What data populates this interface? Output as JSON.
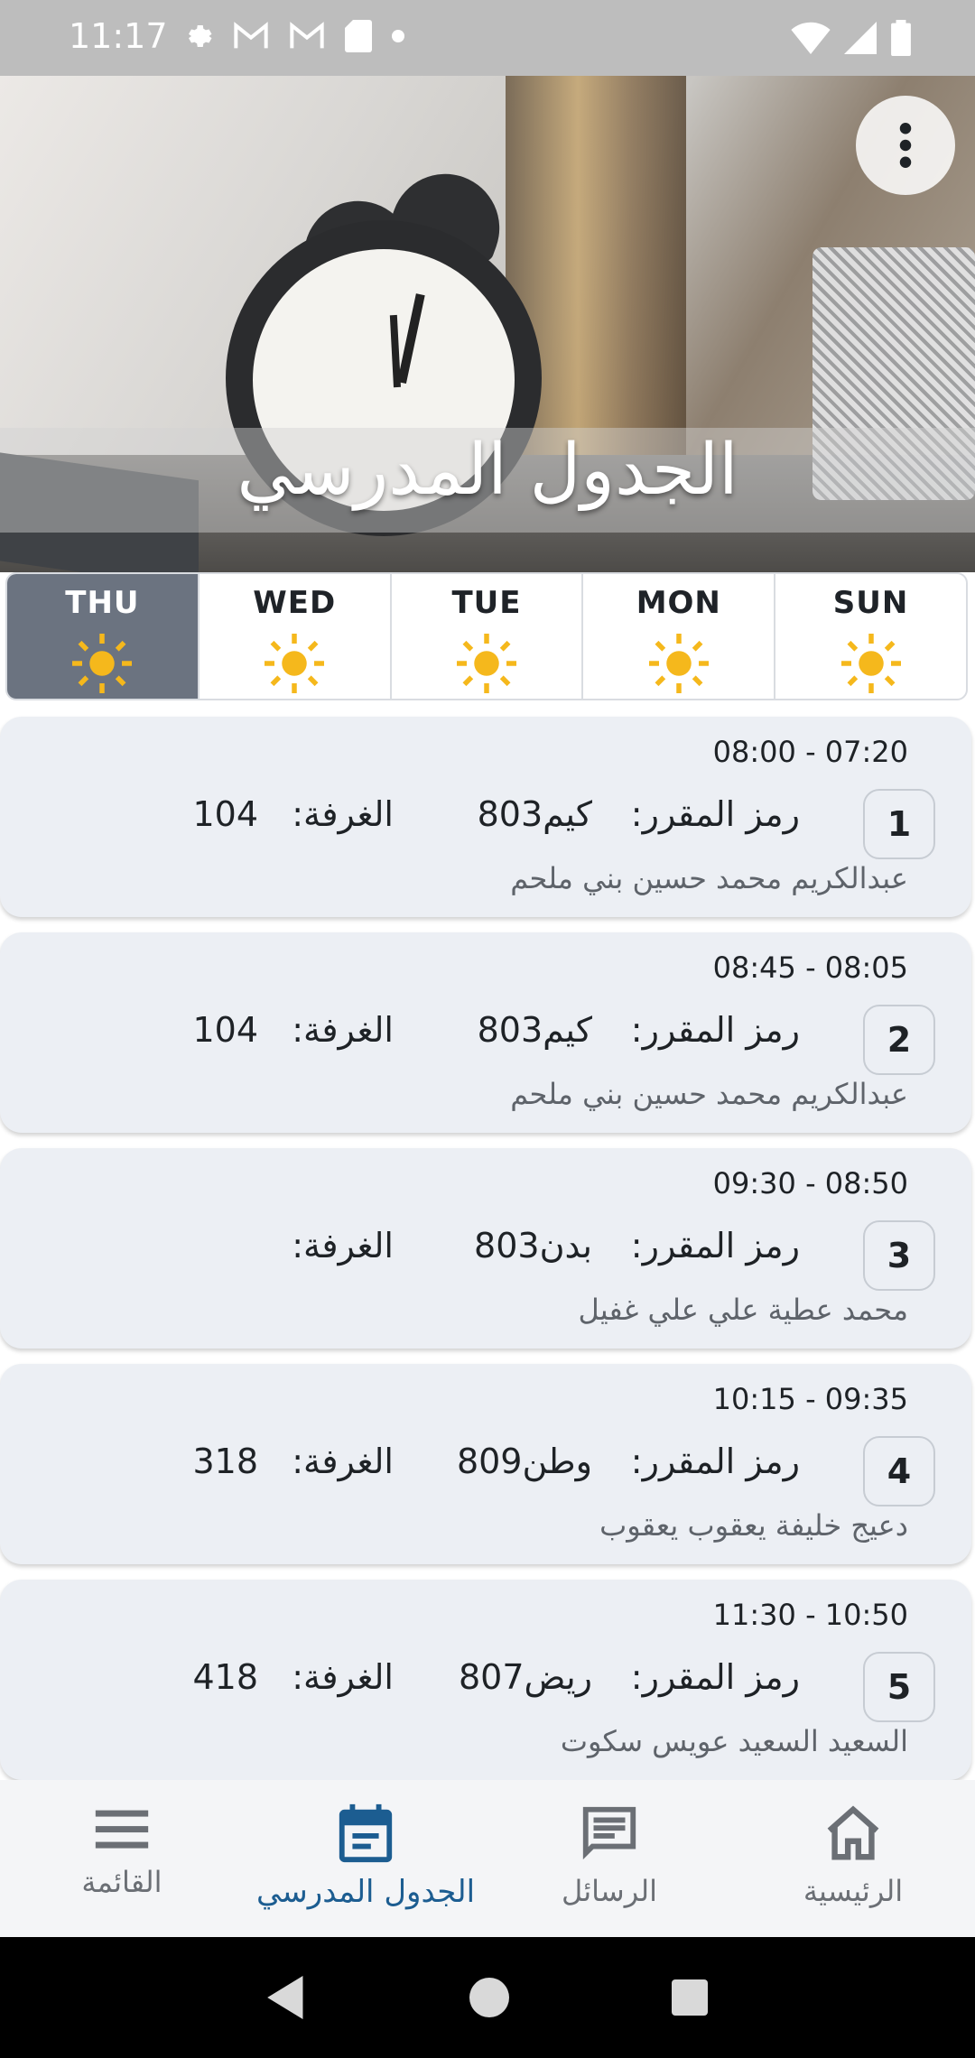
{
  "status_bar": {
    "time": "11:17",
    "icons": [
      "settings-icon",
      "gmail-icon",
      "gmail-icon",
      "sd-card-icon",
      "dot-icon",
      "wifi-icon",
      "signal-icon",
      "battery-icon"
    ]
  },
  "header": {
    "title": "الجدول المدرسي"
  },
  "days": [
    {
      "label": "THU",
      "active": true
    },
    {
      "label": "WED",
      "active": false
    },
    {
      "label": "TUE",
      "active": false
    },
    {
      "label": "MON",
      "active": false
    },
    {
      "label": "SUN",
      "active": false
    }
  ],
  "labels": {
    "course": "رمز المقرر:",
    "room": "الغرفة:"
  },
  "periods": [
    {
      "number": "1",
      "time": "08:00 - 07:20",
      "course_code": "كيم803",
      "room": "104",
      "teacher": "عبدالكريم محمد حسين بني ملحم"
    },
    {
      "number": "2",
      "time": "08:45 - 08:05",
      "course_code": "كيم803",
      "room": "104",
      "teacher": "عبدالكريم محمد حسين بني ملحم"
    },
    {
      "number": "3",
      "time": "09:30 - 08:50",
      "course_code": "بدن803",
      "room": "",
      "teacher": "محمد عطية علي علي غفيل"
    },
    {
      "number": "4",
      "time": "10:15 - 09:35",
      "course_code": "وطن809",
      "room": "318",
      "teacher": "دعيج خليفة يعقوب يعقوب"
    },
    {
      "number": "5",
      "time": "11:30 - 10:50",
      "course_code": "ريض807",
      "room": "418",
      "teacher": "السعيد السعيد عويس سكوت"
    }
  ],
  "bottom_nav": [
    {
      "label": "القائمة",
      "icon": "menu-icon",
      "active": false
    },
    {
      "label": "الجدول المدرسي",
      "icon": "calendar-icon",
      "active": true
    },
    {
      "label": "الرسائل",
      "icon": "messages-icon",
      "active": false
    },
    {
      "label": "الرئيسية",
      "icon": "home-icon",
      "active": false
    }
  ],
  "colors": {
    "active_day": "#6b7380",
    "sun": "#f5b81c",
    "accent": "#1c5d91",
    "card_bg": "#eceff4"
  }
}
